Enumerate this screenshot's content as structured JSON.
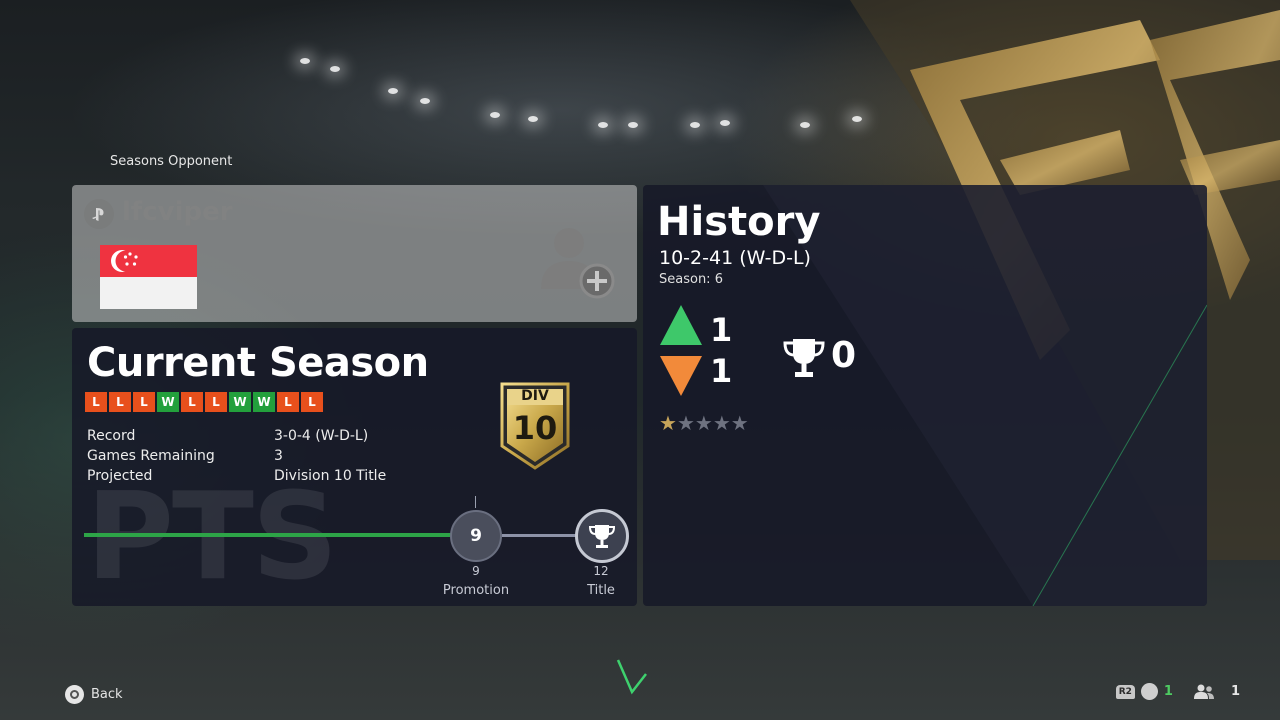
{
  "header": {
    "section_label": "Seasons Opponent"
  },
  "opponent": {
    "name": "lfcviper",
    "flag": "singapore-flag",
    "platform_icon": "playstation-icon",
    "add_friend_icon": "add-friend-icon"
  },
  "current_season": {
    "title": "Current Season",
    "form": [
      "L",
      "L",
      "L",
      "W",
      "L",
      "L",
      "W",
      "W",
      "L",
      "L"
    ],
    "record_label": "Record",
    "record_value": "3-0-4 (W-D-L)",
    "games_remaining_label": "Games Remaining",
    "games_remaining_value": "3",
    "projected_label": "Projected",
    "projected_value": "Division 10 Title",
    "division_badge": {
      "top": "DIV",
      "number": "10"
    },
    "watermark": "PTS",
    "progress": {
      "current_points": "9",
      "promotion_value": "9",
      "promotion_label": "Promotion",
      "title_value": "12",
      "title_label": "Title"
    }
  },
  "history": {
    "title": "History",
    "record": "10-2-41 (W-D-L)",
    "season": "Season: 6",
    "promotions": "1",
    "relegations": "1",
    "titles": "0",
    "star_rating": {
      "filled": 0.5,
      "max": 5
    }
  },
  "footer": {
    "back_label": "Back",
    "r2_label": "R2",
    "voice_count": "1",
    "party_count": "1"
  },
  "colors": {
    "loss": "#e8501c",
    "win": "#23a03c",
    "promotion_arrow": "#3ec86a",
    "relegation_arrow": "#f28a3a",
    "progress_green": "#2da447",
    "gold": "#c9a84a"
  }
}
